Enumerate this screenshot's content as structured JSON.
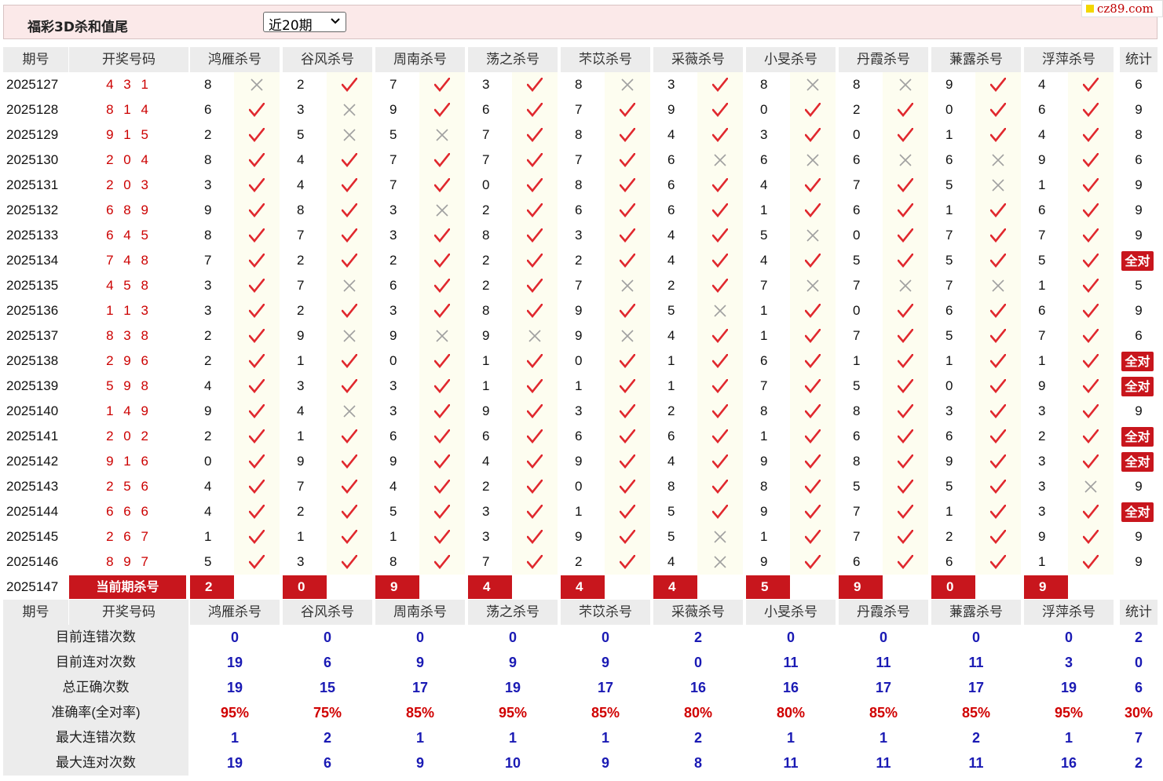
{
  "header": {
    "title": "福彩3D杀和值尾",
    "period_select": {
      "selected": "近20期"
    },
    "brand": "cz89.com"
  },
  "table": {
    "col_headers": [
      "期号",
      "开奖号码",
      "鸿雁杀号",
      "谷风杀号",
      "周南杀号",
      "荡之杀号",
      "芣苡杀号",
      "采薇杀号",
      "小旻杀号",
      "丹霞杀号",
      "蒹露杀号",
      "浮萍杀号",
      "统计"
    ],
    "rows": [
      {
        "id": "2025127",
        "draw": "4 3 1",
        "kills": [
          8,
          2,
          7,
          3,
          8,
          3,
          8,
          8,
          9,
          4
        ],
        "hits": [
          0,
          1,
          1,
          1,
          0,
          1,
          0,
          0,
          1,
          1
        ],
        "tally": "6"
      },
      {
        "id": "2025128",
        "draw": "8 1 4",
        "kills": [
          6,
          3,
          9,
          6,
          7,
          9,
          0,
          2,
          0,
          6
        ],
        "hits": [
          1,
          0,
          1,
          1,
          1,
          1,
          1,
          1,
          1,
          1
        ],
        "tally": "9"
      },
      {
        "id": "2025129",
        "draw": "9 1 5",
        "kills": [
          2,
          5,
          5,
          7,
          8,
          4,
          3,
          0,
          1,
          4
        ],
        "hits": [
          1,
          0,
          0,
          1,
          1,
          1,
          1,
          1,
          1,
          1
        ],
        "tally": "8"
      },
      {
        "id": "2025130",
        "draw": "2 0 4",
        "kills": [
          8,
          4,
          7,
          7,
          7,
          6,
          6,
          6,
          6,
          9
        ],
        "hits": [
          1,
          1,
          1,
          1,
          1,
          0,
          0,
          0,
          0,
          1
        ],
        "tally": "6"
      },
      {
        "id": "2025131",
        "draw": "2 0 3",
        "kills": [
          3,
          4,
          7,
          0,
          8,
          6,
          4,
          7,
          5,
          1
        ],
        "hits": [
          1,
          1,
          1,
          1,
          1,
          1,
          1,
          1,
          0,
          1
        ],
        "tally": "9"
      },
      {
        "id": "2025132",
        "draw": "6 8 9",
        "kills": [
          9,
          8,
          3,
          2,
          6,
          6,
          1,
          6,
          1,
          6
        ],
        "hits": [
          1,
          1,
          0,
          1,
          1,
          1,
          1,
          1,
          1,
          1
        ],
        "tally": "9"
      },
      {
        "id": "2025133",
        "draw": "6 4 5",
        "kills": [
          8,
          7,
          3,
          8,
          3,
          4,
          5,
          0,
          7,
          7
        ],
        "hits": [
          1,
          1,
          1,
          1,
          1,
          1,
          0,
          1,
          1,
          1
        ],
        "tally": "9"
      },
      {
        "id": "2025134",
        "draw": "7 4 8",
        "kills": [
          7,
          2,
          2,
          2,
          2,
          4,
          4,
          5,
          5,
          5
        ],
        "hits": [
          1,
          1,
          1,
          1,
          1,
          1,
          1,
          1,
          1,
          1
        ],
        "tally": "全对"
      },
      {
        "id": "2025135",
        "draw": "4 5 8",
        "kills": [
          3,
          7,
          6,
          2,
          7,
          2,
          7,
          7,
          7,
          1
        ],
        "hits": [
          1,
          0,
          1,
          1,
          0,
          1,
          0,
          0,
          0,
          1
        ],
        "tally": "5"
      },
      {
        "id": "2025136",
        "draw": "1 1 3",
        "kills": [
          3,
          2,
          3,
          8,
          9,
          5,
          1,
          0,
          6,
          6
        ],
        "hits": [
          1,
          1,
          1,
          1,
          1,
          0,
          1,
          1,
          1,
          1
        ],
        "tally": "9"
      },
      {
        "id": "2025137",
        "draw": "8 3 8",
        "kills": [
          2,
          9,
          9,
          9,
          9,
          4,
          1,
          7,
          5,
          7
        ],
        "hits": [
          1,
          0,
          0,
          0,
          0,
          1,
          1,
          1,
          1,
          1
        ],
        "tally": "6"
      },
      {
        "id": "2025138",
        "draw": "2 9 6",
        "kills": [
          2,
          1,
          0,
          1,
          0,
          1,
          6,
          1,
          1,
          1
        ],
        "hits": [
          1,
          1,
          1,
          1,
          1,
          1,
          1,
          1,
          1,
          1
        ],
        "tally": "全对"
      },
      {
        "id": "2025139",
        "draw": "5 9 8",
        "kills": [
          4,
          3,
          3,
          1,
          1,
          1,
          7,
          5,
          0,
          9
        ],
        "hits": [
          1,
          1,
          1,
          1,
          1,
          1,
          1,
          1,
          1,
          1
        ],
        "tally": "全对"
      },
      {
        "id": "2025140",
        "draw": "1 4 9",
        "kills": [
          9,
          4,
          3,
          9,
          3,
          2,
          8,
          8,
          3,
          3
        ],
        "hits": [
          1,
          0,
          1,
          1,
          1,
          1,
          1,
          1,
          1,
          1
        ],
        "tally": "9"
      },
      {
        "id": "2025141",
        "draw": "2 0 2",
        "kills": [
          2,
          1,
          6,
          6,
          6,
          6,
          1,
          6,
          6,
          2
        ],
        "hits": [
          1,
          1,
          1,
          1,
          1,
          1,
          1,
          1,
          1,
          1
        ],
        "tally": "全对"
      },
      {
        "id": "2025142",
        "draw": "9 1 6",
        "kills": [
          0,
          9,
          9,
          4,
          9,
          4,
          9,
          8,
          9,
          3
        ],
        "hits": [
          1,
          1,
          1,
          1,
          1,
          1,
          1,
          1,
          1,
          1
        ],
        "tally": "全对"
      },
      {
        "id": "2025143",
        "draw": "2 5 6",
        "kills": [
          4,
          7,
          4,
          2,
          0,
          8,
          8,
          5,
          5,
          3
        ],
        "hits": [
          1,
          1,
          1,
          1,
          1,
          1,
          1,
          1,
          1,
          0
        ],
        "tally": "9"
      },
      {
        "id": "2025144",
        "draw": "6 6 6",
        "kills": [
          4,
          2,
          5,
          3,
          1,
          5,
          9,
          7,
          1,
          3
        ],
        "hits": [
          1,
          1,
          1,
          1,
          1,
          1,
          1,
          1,
          1,
          1
        ],
        "tally": "全对"
      },
      {
        "id": "2025145",
        "draw": "2 6 7",
        "kills": [
          1,
          1,
          1,
          3,
          9,
          5,
          1,
          7,
          2,
          9
        ],
        "hits": [
          1,
          1,
          1,
          1,
          1,
          0,
          1,
          1,
          1,
          1
        ],
        "tally": "9"
      },
      {
        "id": "2025146",
        "draw": "8 9 7",
        "kills": [
          5,
          3,
          8,
          7,
          2,
          4,
          9,
          6,
          6,
          1
        ],
        "hits": [
          1,
          1,
          1,
          1,
          1,
          0,
          1,
          1,
          1,
          1
        ],
        "tally": "9"
      }
    ],
    "current": {
      "id": "2025147",
      "label": "当前期杀号",
      "kills": [
        2,
        0,
        9,
        4,
        4,
        4,
        5,
        9,
        0,
        9
      ]
    },
    "stats": [
      {
        "label": "目前连错次数",
        "values": [
          "0",
          "0",
          "0",
          "0",
          "0",
          "2",
          "0",
          "0",
          "0",
          "0",
          "2"
        ]
      },
      {
        "label": "目前连对次数",
        "values": [
          "19",
          "6",
          "9",
          "9",
          "9",
          "0",
          "11",
          "11",
          "11",
          "3",
          "0"
        ]
      },
      {
        "label": "总正确次数",
        "values": [
          "19",
          "15",
          "17",
          "19",
          "17",
          "16",
          "16",
          "17",
          "17",
          "19",
          "6"
        ]
      },
      {
        "label": "准确率(全对率)",
        "values": [
          "95%",
          "75%",
          "85%",
          "95%",
          "85%",
          "80%",
          "80%",
          "85%",
          "85%",
          "95%",
          "30%"
        ],
        "red": true
      },
      {
        "label": "最大连错次数",
        "values": [
          "1",
          "2",
          "1",
          "1",
          "1",
          "2",
          "1",
          "1",
          "2",
          "1",
          "7"
        ]
      },
      {
        "label": "最大连对次数",
        "values": [
          "19",
          "6",
          "9",
          "10",
          "9",
          "8",
          "11",
          "11",
          "11",
          "16",
          "2"
        ]
      }
    ]
  },
  "colors": {
    "accent_red": "#c8161d",
    "check_red": "#e0282e",
    "cross_gray": "#a0a0a0",
    "stat_blue": "#1a1ab4"
  }
}
